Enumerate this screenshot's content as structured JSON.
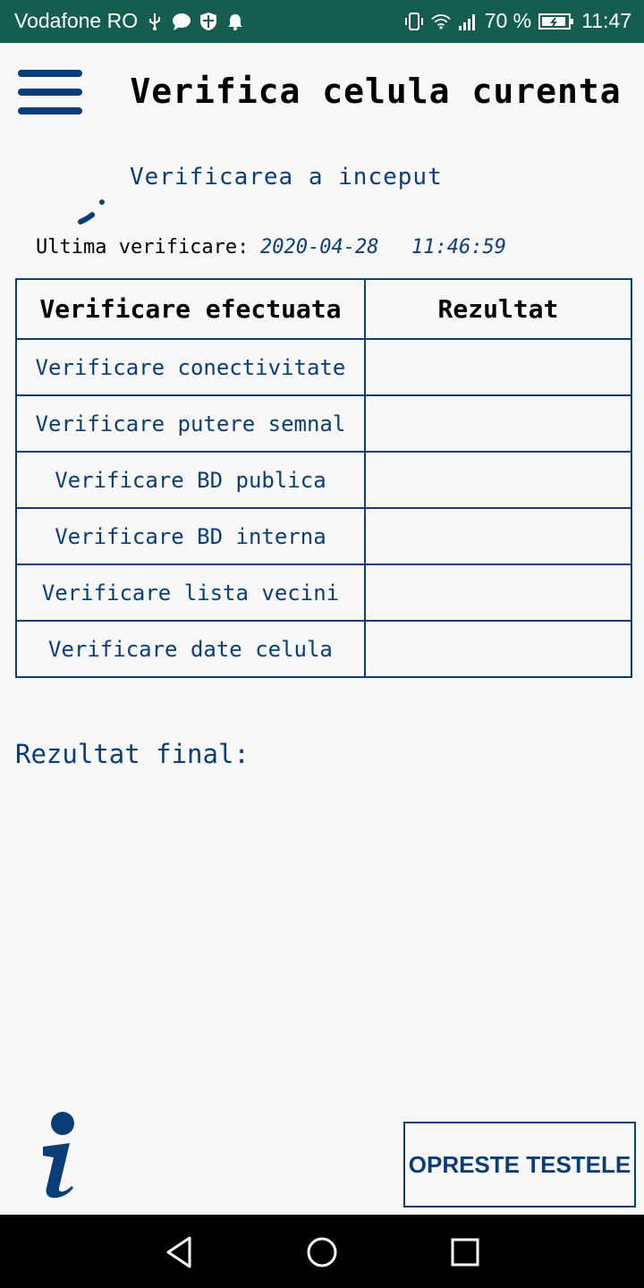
{
  "status_bar": {
    "carrier": "Vodafone RO",
    "battery_percent": "70 %",
    "time": "11:47",
    "left_icons": [
      "usb-icon",
      "message-icon",
      "shield-icon",
      "bell-icon"
    ],
    "right_icons": [
      "vibrate-icon",
      "wifi-icon",
      "signal-icon",
      "battery-icon"
    ]
  },
  "header": {
    "title": "Verifica celula curenta",
    "menu_icon": "hamburger-menu-icon"
  },
  "progress": {
    "status_text": "Verificarea a inceput",
    "last_check_label": "Ultima verificare:",
    "last_check_date": "2020-04-28",
    "last_check_time": "11:46:59"
  },
  "table": {
    "headers": [
      "Verificare efectuata",
      "Rezultat"
    ],
    "rows": [
      {
        "check": "Verificare conectivitate",
        "result": ""
      },
      {
        "check": "Verificare putere semnal",
        "result": ""
      },
      {
        "check": "Verificare BD publica",
        "result": ""
      },
      {
        "check": "Verificare BD interna",
        "result": ""
      },
      {
        "check": "Verificare lista vecini",
        "result": ""
      },
      {
        "check": "Verificare date celula",
        "result": ""
      }
    ]
  },
  "final_result": {
    "label": "Rezultat final:",
    "value": ""
  },
  "actions": {
    "info_icon": "info-icon",
    "stop_label": "OPRESTE TESTELE"
  },
  "nav_bar": {
    "icons": [
      "back-icon",
      "home-icon",
      "recents-icon"
    ]
  },
  "colors": {
    "status_bar": "#155e4f",
    "accent": "#0b3d78",
    "background": "#f8f8f8"
  }
}
